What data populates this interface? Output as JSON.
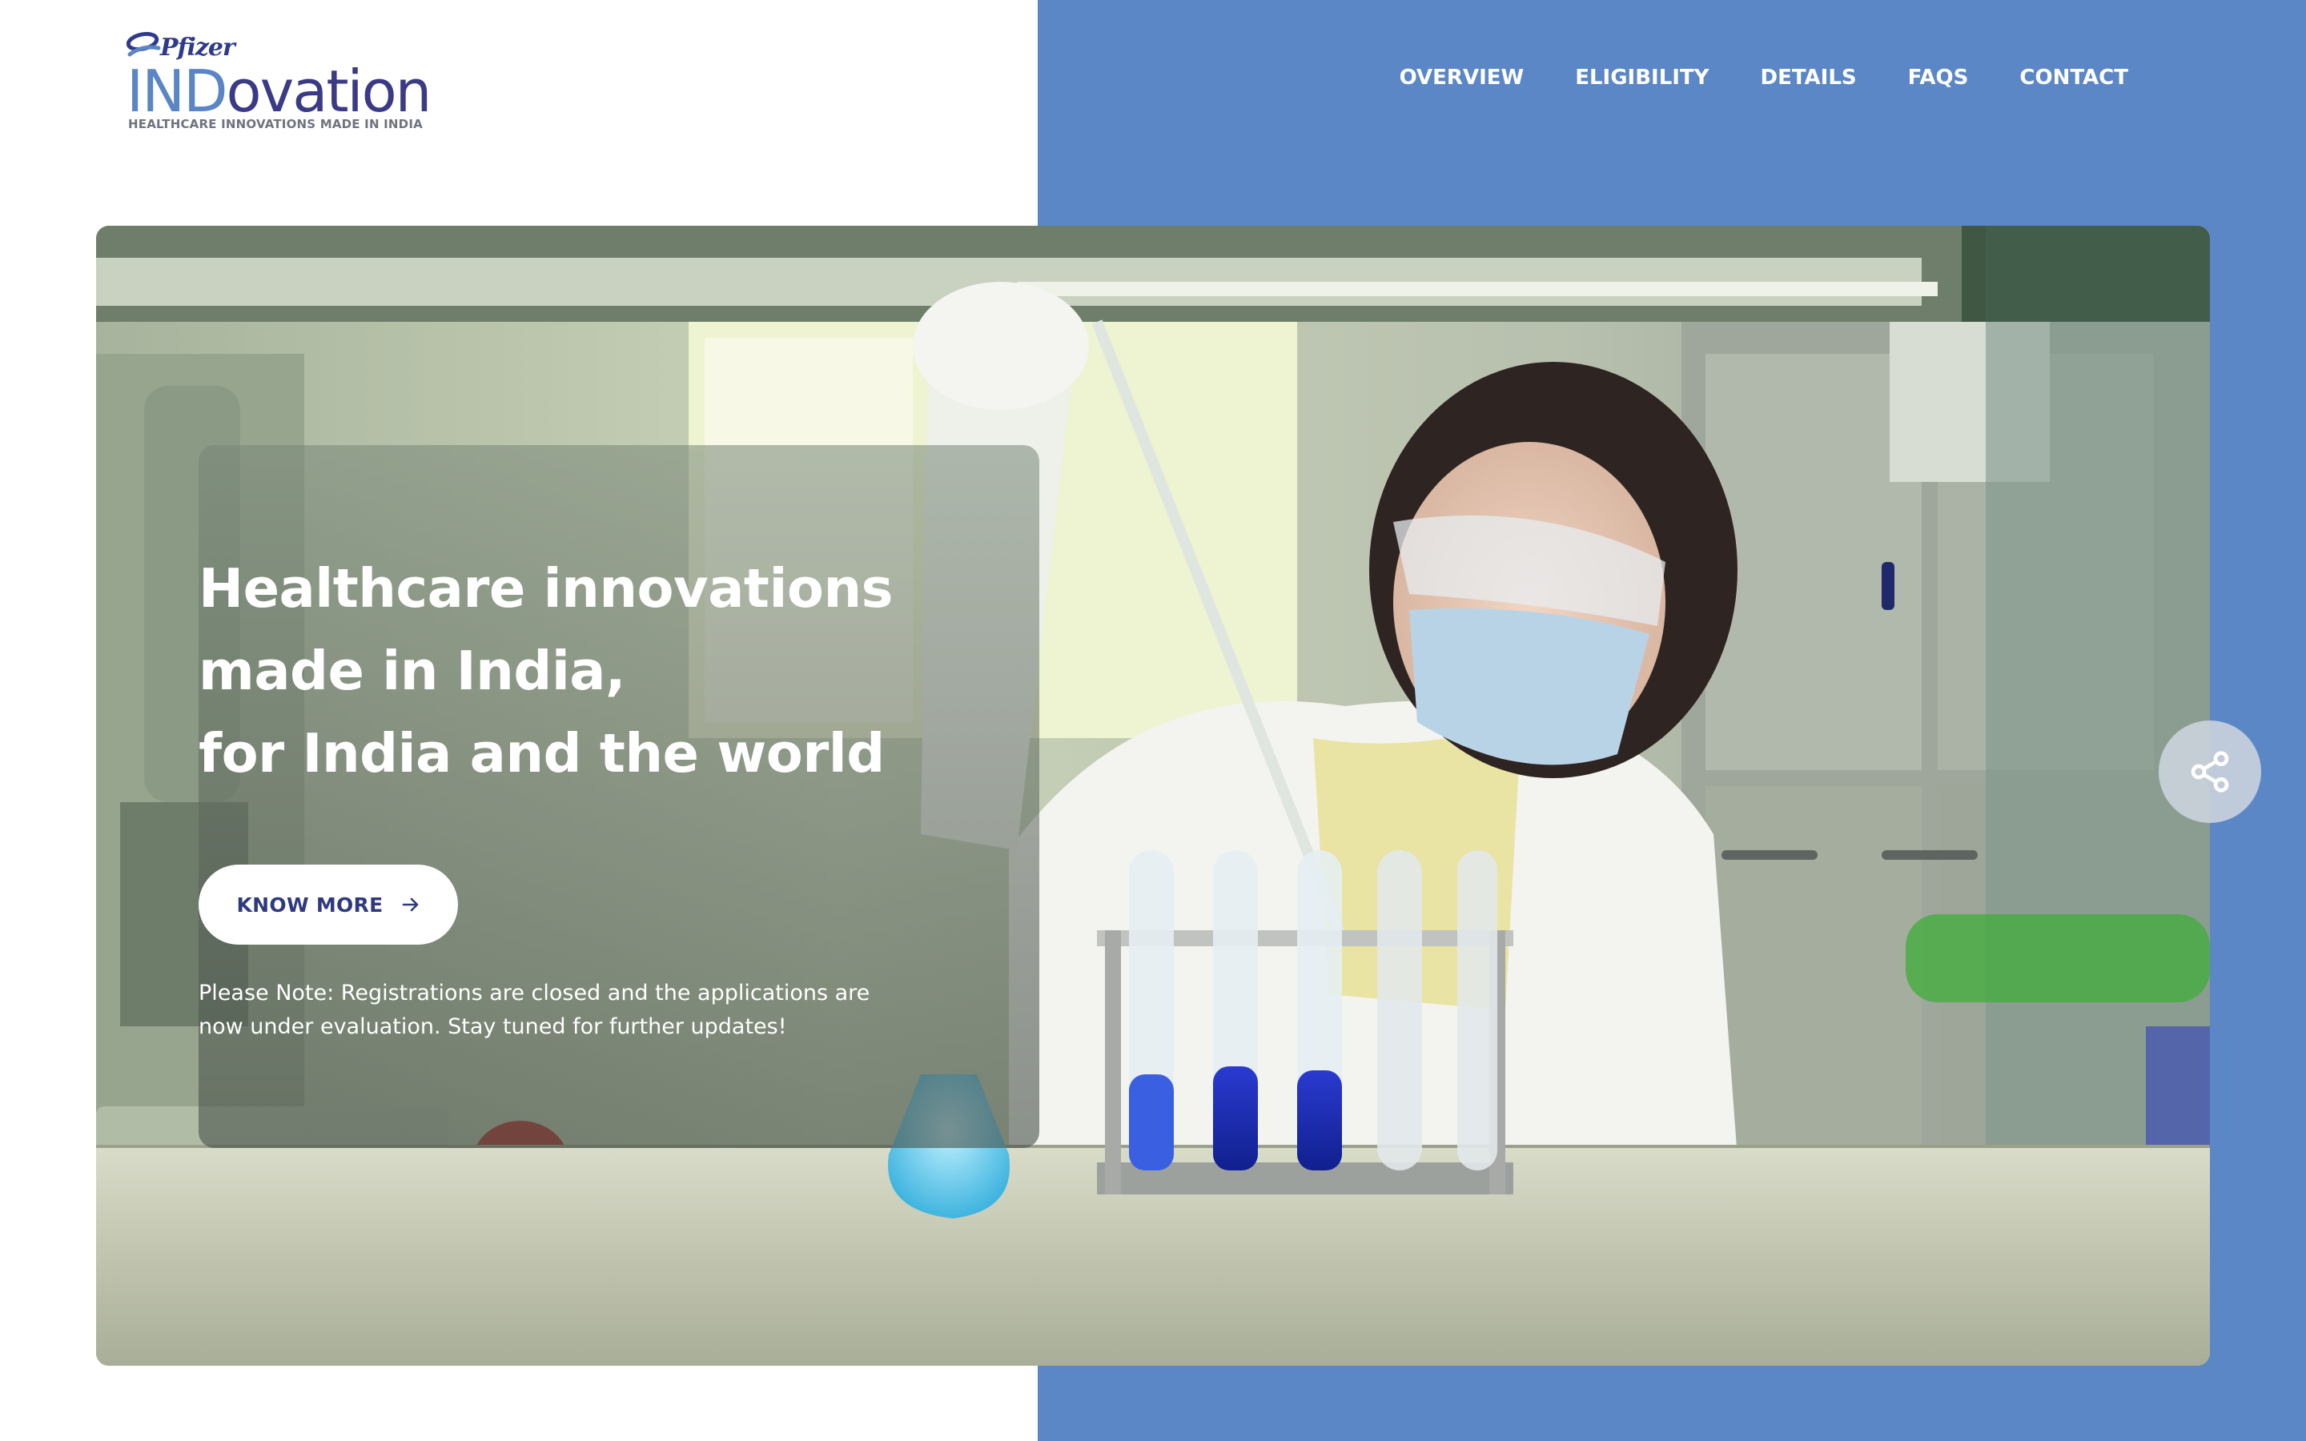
{
  "brand": {
    "company": "Pfizer",
    "name_part1": "IND",
    "name_part2": "ovation",
    "tagline": "HEALTHCARE INNOVATIONS MADE IN INDIA"
  },
  "nav": {
    "items": [
      {
        "label": "OVERVIEW"
      },
      {
        "label": "ELIGIBILITY"
      },
      {
        "label": "DETAILS"
      },
      {
        "label": "FAQS"
      },
      {
        "label": "CONTACT"
      }
    ]
  },
  "hero": {
    "headline_lines": [
      "Healthcare innovations",
      "made in India,",
      "for India and the world"
    ],
    "cta_label": "KNOW MORE",
    "note": "Please Note: Registrations are closed and the applications are now under evaluation. Stay tuned for further updates!"
  },
  "icons": {
    "cta": "arrow-right-icon",
    "share": "share-icon",
    "logo": "pfizer-logo-icon"
  },
  "colors": {
    "accent_blue": "#5b87c6",
    "brand_navy": "#3b3a86",
    "button_text": "#2f3a7e"
  }
}
